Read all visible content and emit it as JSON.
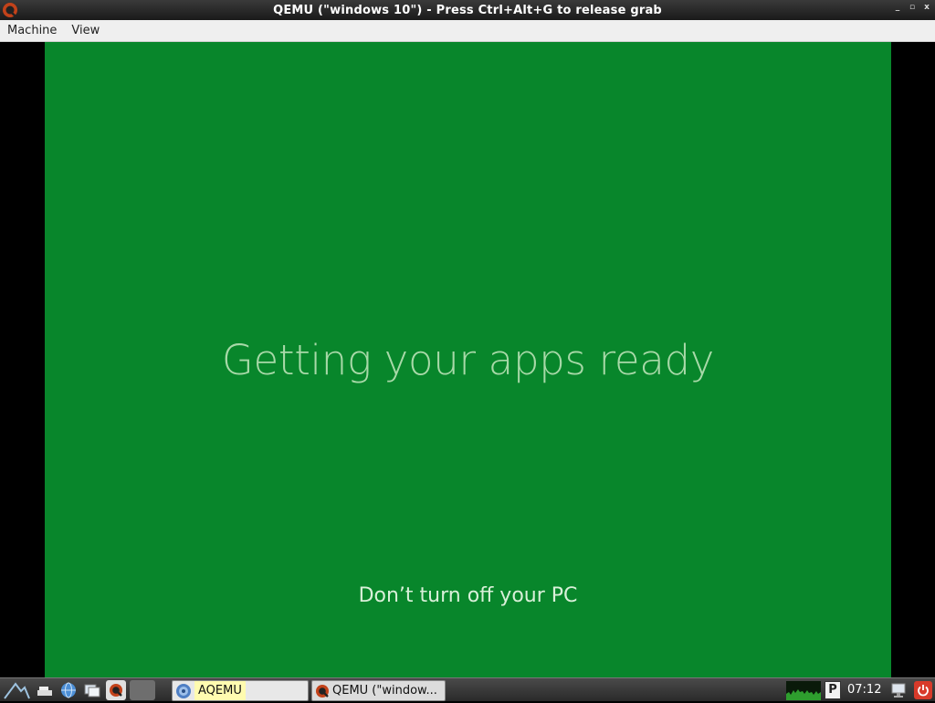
{
  "window": {
    "title": "QEMU (\"windows 10\") - Press Ctrl+Alt+G to release grab",
    "controls": [
      "_",
      "▫",
      "x"
    ]
  },
  "menubar": {
    "items": [
      "Machine",
      "View"
    ]
  },
  "guest": {
    "headline": "Getting your apps ready",
    "subline": "Don’t turn off your PC",
    "background": "#08862b"
  },
  "taskbar": {
    "tasks": [
      {
        "label": "AQEMU"
      },
      {
        "label": "QEMU (\"window..."
      }
    ],
    "tray": {
      "clock": "07:12",
      "pager_label": "P"
    }
  },
  "colors": {
    "guest_bg": "#08862b",
    "headline": "#a8d9a8",
    "power": "#d83a2a"
  }
}
